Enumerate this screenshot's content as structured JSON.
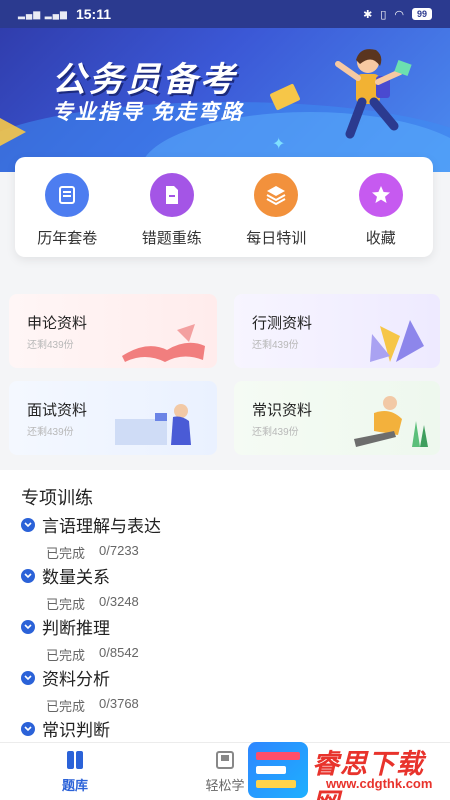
{
  "status_bar": {
    "signal": "▂▄▆ ▂▄▆",
    "time": "15:11",
    "bluetooth": "✱",
    "vibrate": "▯",
    "wifi": "◠",
    "battery": "99"
  },
  "banner": {
    "title": "公务员备考",
    "subtitle": "专业指导 免走弯路"
  },
  "quick_actions": [
    {
      "label": "历年套卷",
      "icon": "scroll-icon",
      "color": "#4d7df0"
    },
    {
      "label": "错题重练",
      "icon": "document-icon",
      "color": "#a455e6"
    },
    {
      "label": "每日特训",
      "icon": "layers-icon",
      "color": "#f2913c"
    },
    {
      "label": "收藏",
      "icon": "star-icon",
      "color": "#c65af0"
    }
  ],
  "materials": [
    {
      "title": "申论资料",
      "sub": "还剩439份"
    },
    {
      "title": "行测资料",
      "sub": "还剩439份"
    },
    {
      "title": "面试资料",
      "sub": "还剩439份"
    },
    {
      "title": "常识资料",
      "sub": "还剩439份"
    }
  ],
  "training": {
    "title": "专项训练",
    "items": [
      {
        "name": "言语理解与表达",
        "status": "已完成",
        "progress": "0/7233"
      },
      {
        "name": "数量关系",
        "status": "已完成",
        "progress": "0/3248"
      },
      {
        "name": "判断推理",
        "status": "已完成",
        "progress": "0/8542"
      },
      {
        "name": "资料分析",
        "status": "已完成",
        "progress": "0/3768"
      },
      {
        "name": "常识判断"
      }
    ]
  },
  "tabs": [
    {
      "label": "题库",
      "active": true
    },
    {
      "label": "轻松学",
      "active": false
    }
  ],
  "watermark": {
    "cn": "睿思下载网",
    "en": "www.cdgthk.com"
  },
  "accent_color": "#2b62d8"
}
